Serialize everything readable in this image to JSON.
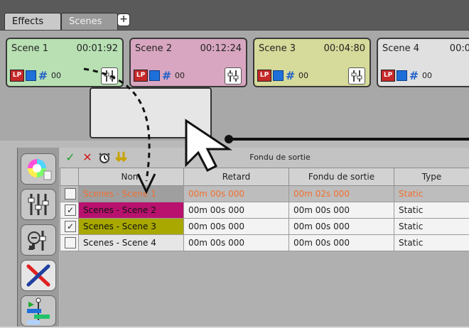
{
  "tabs": {
    "effects": "Effects",
    "scenes": "Scenes",
    "add": "+"
  },
  "scenes": [
    {
      "name": "Scene 1",
      "time": "00:01:92",
      "lp": "LP",
      "count": "00",
      "color": "#b8e0b3"
    },
    {
      "name": "Scene 2",
      "time": "00:12:24",
      "lp": "LP",
      "count": "00",
      "color": "#d8a6c0"
    },
    {
      "name": "Scene 3",
      "time": "00:04:80",
      "lp": "LP",
      "count": "00",
      "color": "#d6da9a"
    },
    {
      "name": "Scene 4",
      "time": "00:0",
      "lp": "LP",
      "count": "00",
      "color": "#e0e0e0"
    }
  ],
  "toolbar": {
    "title": "Fondu de sortie"
  },
  "table": {
    "headers": [
      "Nom",
      "Retard",
      "Fondu de sortie",
      "Type"
    ],
    "rows": [
      {
        "checked": "",
        "name": "Scenes - Scene 1",
        "retard": "00m 00s 000",
        "fondu": "00m 02s 000",
        "type": "Static",
        "nameColor": "#9f9f9f",
        "textColor": "#f07030"
      },
      {
        "checked": "✓",
        "name": "Scenes - Scene 2",
        "retard": "00m 00s 000",
        "fondu": "00m 00s 000",
        "type": "Static",
        "nameColor": "#b8126e",
        "textColor": "#111"
      },
      {
        "checked": "✓",
        "name": "Scenes - Scene 3",
        "retard": "00m 00s 000",
        "fondu": "00m 00s 000",
        "type": "Static",
        "nameColor": "#a8a800",
        "textColor": "#111"
      },
      {
        "checked": "",
        "name": "Scenes - Scene 4",
        "retard": "00m 00s 000",
        "fondu": "00m 00s 000",
        "type": "Static",
        "nameColor": "#e6e6e6",
        "textColor": "#111"
      }
    ]
  }
}
